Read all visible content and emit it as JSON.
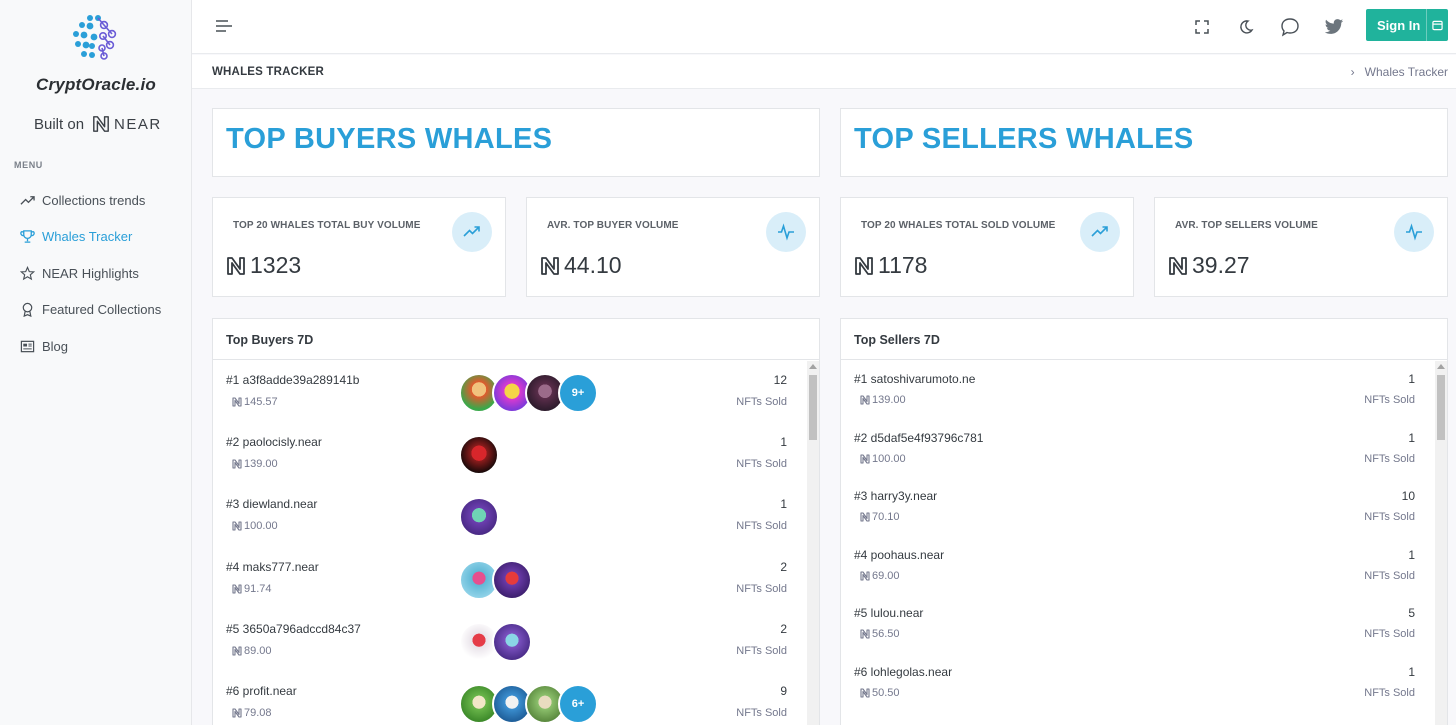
{
  "sidebar": {
    "brand": "CryptOracle.io",
    "built_on": "Built on",
    "near_word": "NEAR",
    "menu_title": "MENU",
    "items": [
      {
        "label": "Collections trends",
        "icon": "trend-line-icon"
      },
      {
        "label": "Whales Tracker",
        "icon": "trophy-icon",
        "active": true
      },
      {
        "label": "NEAR Highlights",
        "icon": "star-icon"
      },
      {
        "label": "Featured Collections",
        "icon": "award-icon"
      },
      {
        "label": "Blog",
        "icon": "newspaper-icon"
      }
    ]
  },
  "topbar": {
    "signin_label": "Sign In"
  },
  "page": {
    "title": "WHALES TRACKER",
    "breadcrumb": "Whales Tracker"
  },
  "buyers": {
    "hero": "TOP BUYERS WHALES",
    "stats": [
      {
        "label": "TOP 20 WHALES TOTAL BUY VOLUME",
        "value": "1323",
        "icon": "trending-up-icon"
      },
      {
        "label": "AVR. TOP BUYER VOLUME",
        "value": "44.10",
        "icon": "activity-icon"
      }
    ],
    "list_title": "Top Buyers 7D",
    "rows": [
      {
        "name": "#1 a3f8adde39a289141b",
        "amount": "145.57",
        "count": "12",
        "sub": "NFTs Sold",
        "avatars": [
          "#e2592d",
          "#d93ad0",
          "#5a2d4a"
        ],
        "more": "9+"
      },
      {
        "name": "#2 paolocisly.near",
        "amount": "139.00",
        "count": "1",
        "sub": "NFTs Sold",
        "avatars": [
          "#8c1c1c"
        ],
        "more": ""
      },
      {
        "name": "#3 diewland.near",
        "amount": "100.00",
        "count": "1",
        "sub": "NFTs Sold",
        "avatars": [
          "#6c3fb0"
        ],
        "more": ""
      },
      {
        "name": "#4 maks777.near",
        "amount": "91.74",
        "count": "2",
        "sub": "NFTs Sold",
        "avatars": [
          "#5fb8d6",
          "#6a3aa8"
        ],
        "more": ""
      },
      {
        "name": "#5 3650a796adccd84c37",
        "amount": "89.00",
        "count": "2",
        "sub": "NFTs Sold",
        "avatars": [
          "#e9e3ea",
          "#7b52c0"
        ],
        "more": ""
      },
      {
        "name": "#6 profit.near",
        "amount": "79.08",
        "count": "9",
        "sub": "NFTs Sold",
        "avatars": [
          "#6ab64a",
          "#3b8fd0",
          "#8cc06c"
        ],
        "more": "6+"
      }
    ]
  },
  "sellers": {
    "hero": "TOP SELLERS WHALES",
    "stats": [
      {
        "label": "TOP 20 WHALES TOTAL SOLD VOLUME",
        "value": "1178",
        "icon": "trending-up-icon"
      },
      {
        "label": "AVR. TOP SELLERS VOLUME",
        "value": "39.27",
        "icon": "activity-icon"
      }
    ],
    "list_title": "Top Sellers 7D",
    "rows": [
      {
        "name": "#1 satoshivarumoto.ne",
        "amount": "139.00",
        "count": "1",
        "sub": "NFTs Sold"
      },
      {
        "name": "#2 d5daf5e4f93796c781",
        "amount": "100.00",
        "count": "1",
        "sub": "NFTs Sold"
      },
      {
        "name": "#3 harry3y.near",
        "amount": "70.10",
        "count": "10",
        "sub": "NFTs Sold"
      },
      {
        "name": "#4 poohaus.near",
        "amount": "69.00",
        "count": "1",
        "sub": "NFTs Sold"
      },
      {
        "name": "#5 lulou.near",
        "amount": "56.50",
        "count": "5",
        "sub": "NFTs Sold"
      },
      {
        "name": "#6 lohlegolas.near",
        "amount": "50.50",
        "count": "1",
        "sub": "NFTs Sold"
      }
    ]
  },
  "colors": {
    "accent": "#2a9fd8",
    "signin": "#20b39c"
  }
}
